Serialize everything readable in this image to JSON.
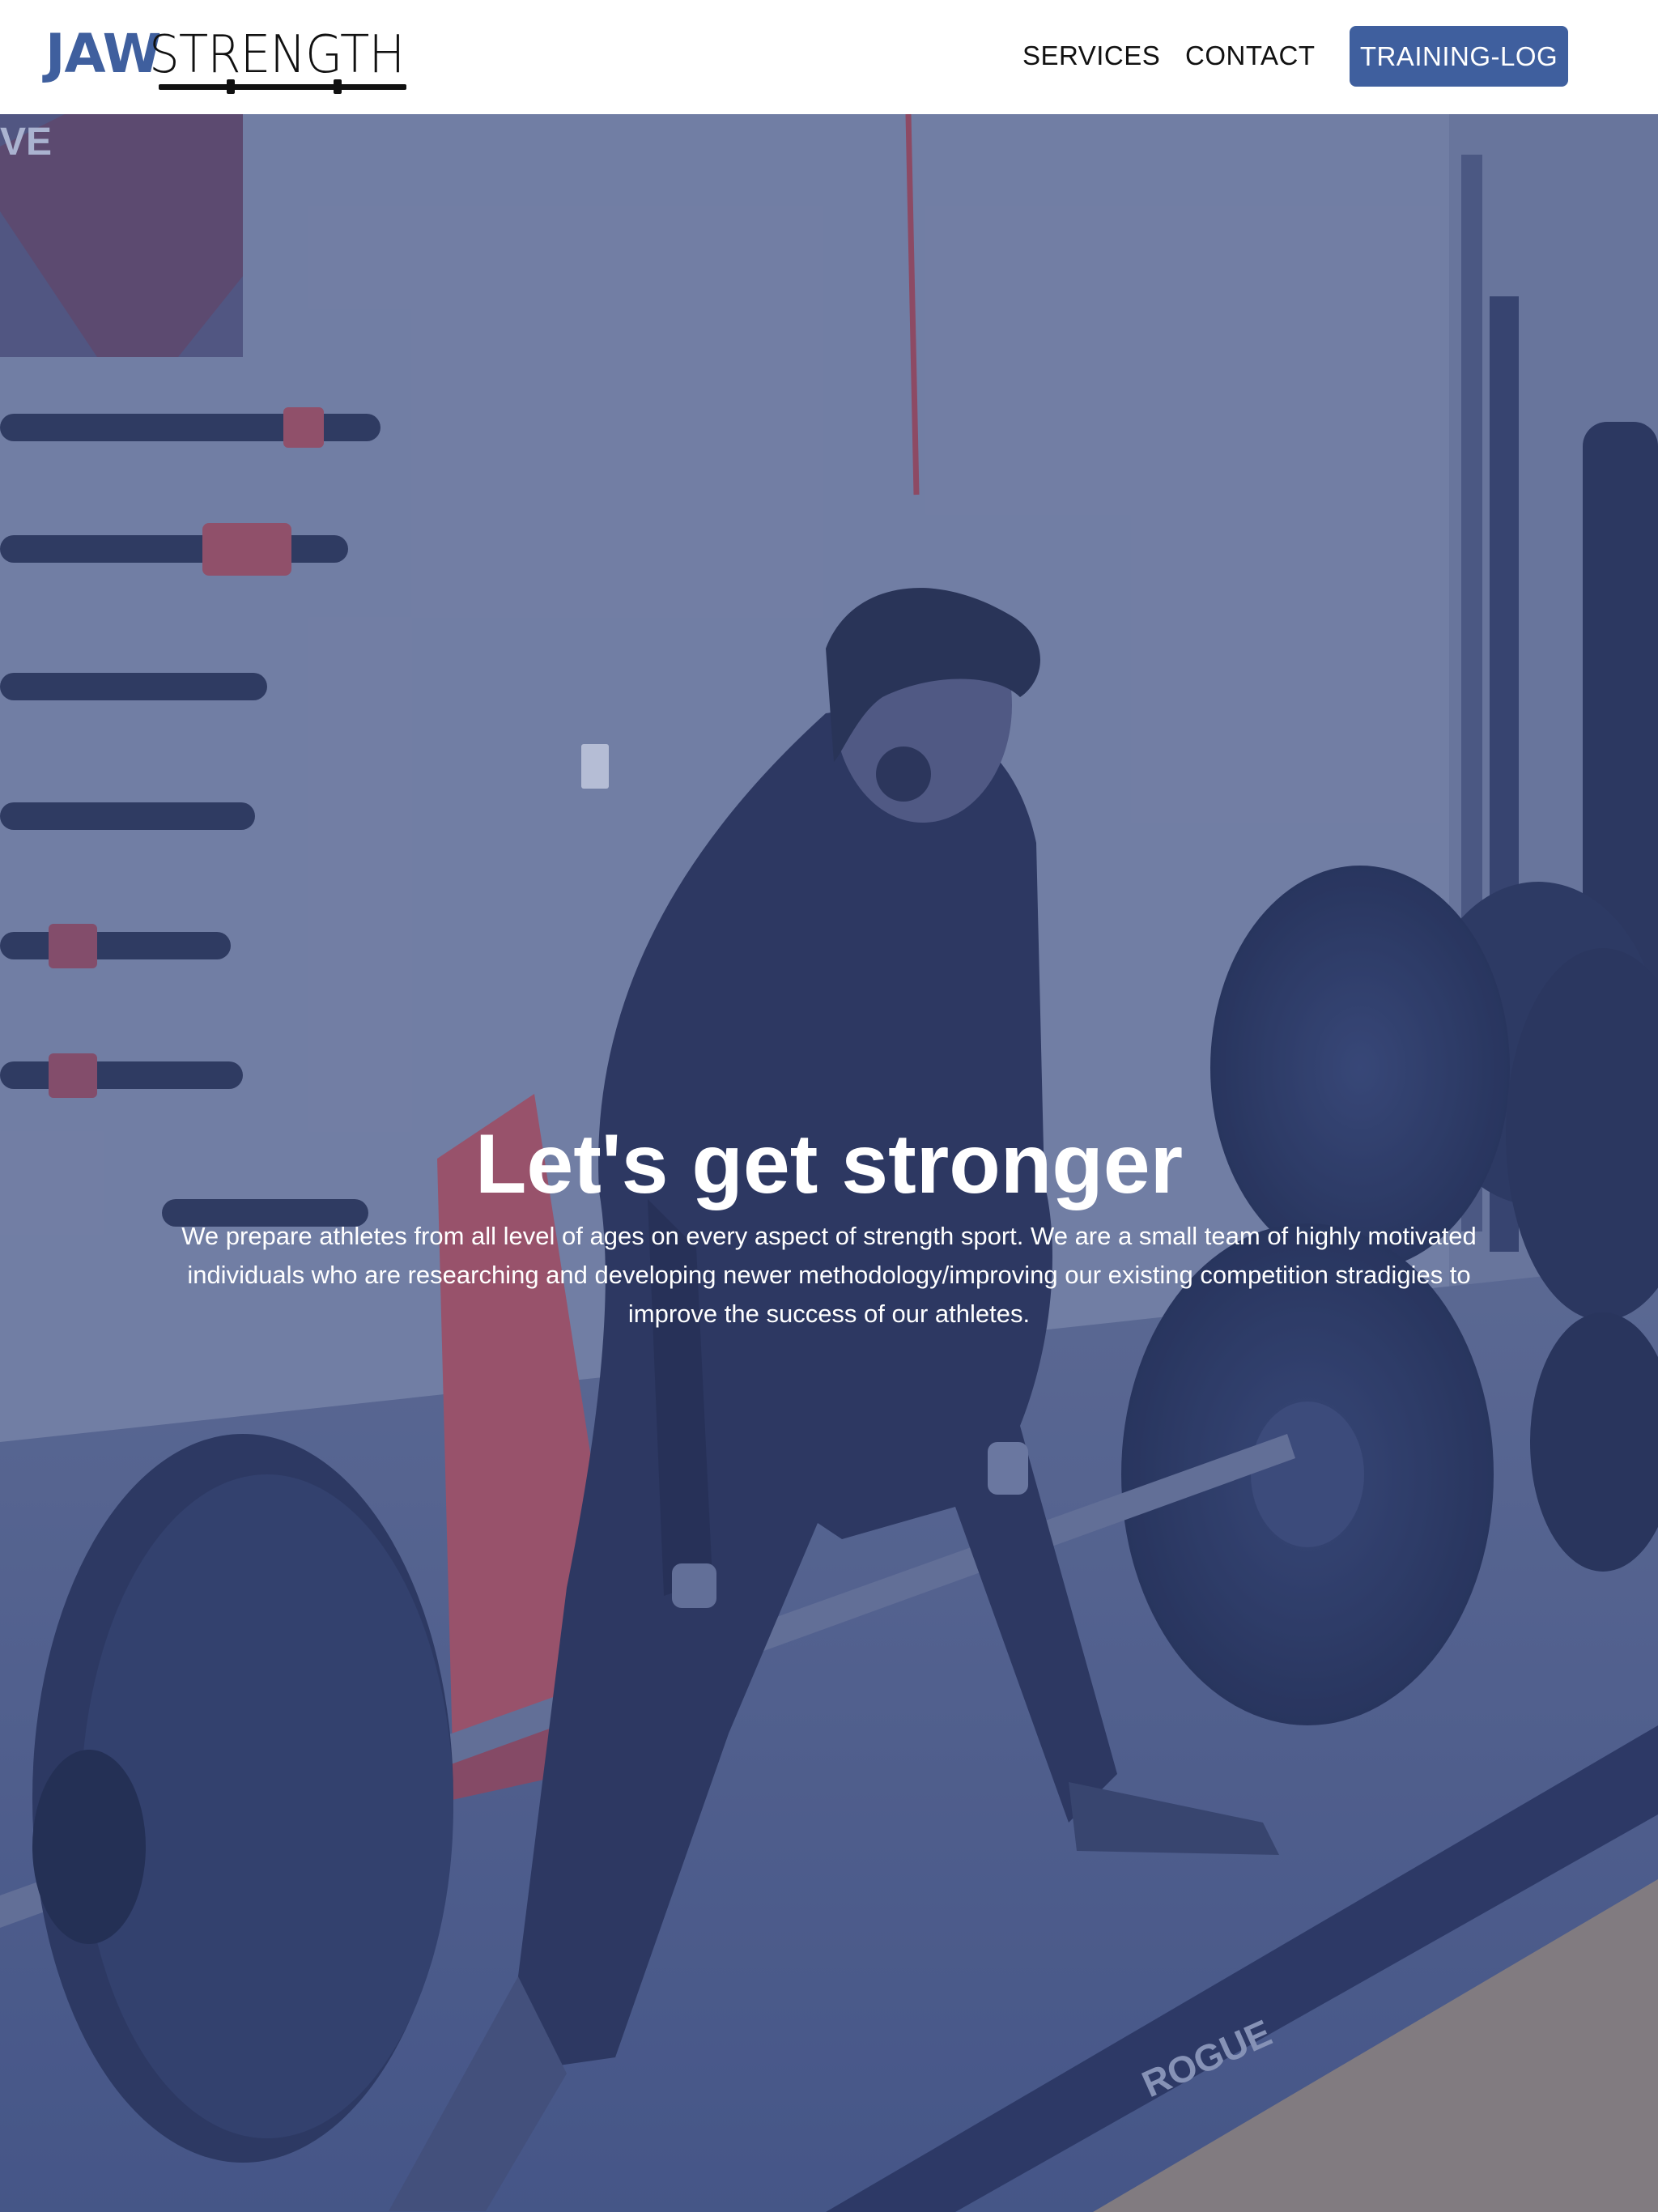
{
  "header": {
    "logo": {
      "part1": "JAW",
      "part2": "STRENGTH"
    },
    "nav": {
      "services": "SERVICES",
      "contact": "CONTACT",
      "training_log": "TRAINING-LOG"
    }
  },
  "hero": {
    "title": "Let's get stronger",
    "description": "We prepare athletes from all level of ages on every aspect of strength sport. We are a small team of highly motivated individuals who are researching and developing newer methodology/improving our existing competition stradigies to improve the success of our athletes.",
    "floor_brand_text": "ROGUE",
    "poster_text": "VE"
  },
  "colors": {
    "brand": "#3f5f9e",
    "overlay": "#344a8c",
    "text_light": "#ffffff",
    "text_dark": "#111111"
  }
}
